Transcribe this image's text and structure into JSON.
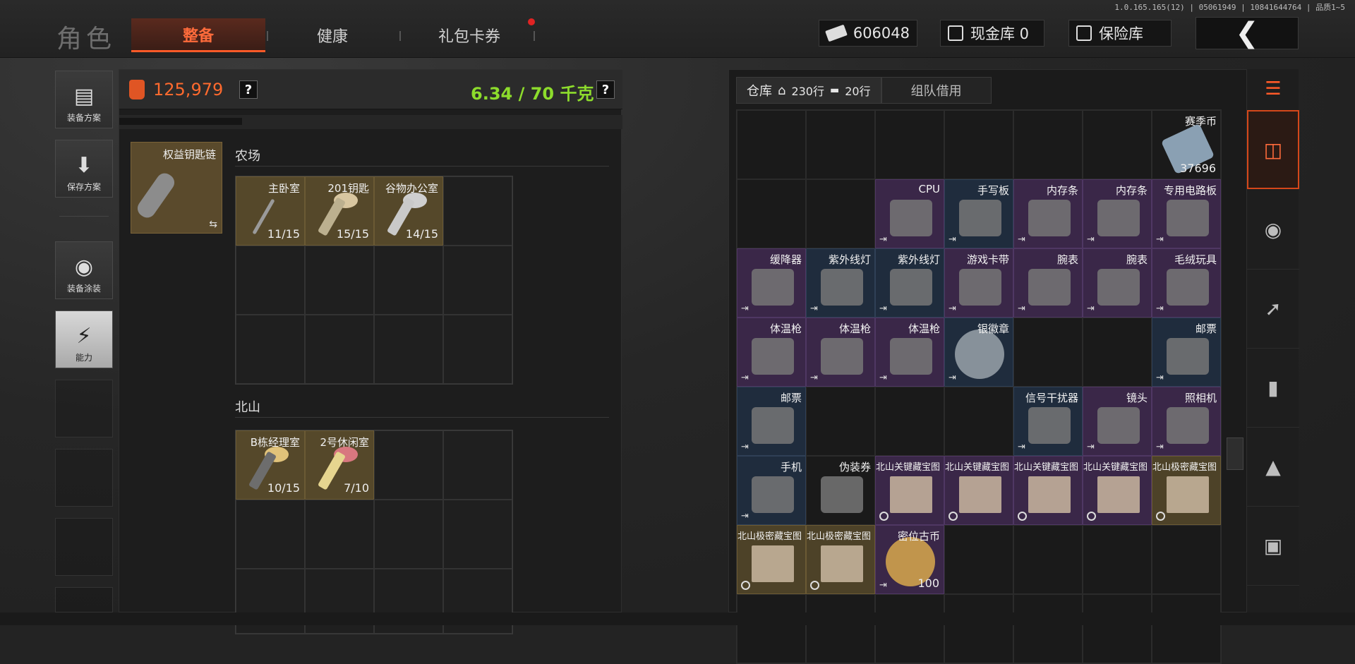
{
  "version": "1.0.165.165(12) | 05061949 | 10841644764 | 品质1~5",
  "header": {
    "role_title": "角色",
    "tabs": [
      "整备",
      "健康",
      "礼包卡券"
    ],
    "cash": "606048",
    "cash_vault": "现金库 0",
    "safe_box": "保险库",
    "back_icon": "back-arrow-icon"
  },
  "sidebar": {
    "items": [
      {
        "label": "装备方案",
        "icon": "vest-icon"
      },
      {
        "label": "保存方案",
        "icon": "save-download-icon"
      },
      {
        "label": "装备涂装",
        "icon": "helmet-paint-icon"
      },
      {
        "label": "能力",
        "icon": "ability-lightning-icon"
      }
    ]
  },
  "loadout": {
    "value": "125,979",
    "weight": "6.34 / 70 千克",
    "help": "?",
    "keychain_label": "权益钥匙链",
    "sections": [
      {
        "title": "农场",
        "keys": [
          {
            "name": "主卧室",
            "count": "11/15"
          },
          {
            "name": "201钥匙",
            "count": "15/15"
          },
          {
            "name": "谷物办公室",
            "count": "14/15"
          }
        ]
      },
      {
        "title": "北山",
        "keys": [
          {
            "name": "B栋经理室",
            "count": "10/15"
          },
          {
            "name": "2号休闲室",
            "count": "7/10"
          }
        ]
      }
    ]
  },
  "warehouse": {
    "tab_label": "仓库",
    "rows_house": "230行",
    "rows_ticket": "20行",
    "team_borrow": "组队借用",
    "items": [
      {
        "name": "",
        "rarity": "empty"
      },
      {
        "name": "",
        "rarity": "empty"
      },
      {
        "name": "",
        "rarity": "empty"
      },
      {
        "name": "",
        "rarity": "empty"
      },
      {
        "name": "",
        "rarity": "empty"
      },
      {
        "name": "",
        "rarity": "empty"
      },
      {
        "name": "赛季币",
        "rarity": "empty",
        "qty": "37696",
        "pic": "money"
      },
      {
        "name": "",
        "rarity": "empty"
      },
      {
        "name": "",
        "rarity": "empty"
      },
      {
        "name": "CPU",
        "rarity": "purple",
        "pic": "chip"
      },
      {
        "name": "手写板",
        "rarity": "blue",
        "pic": "device"
      },
      {
        "name": "内存条",
        "rarity": "purple",
        "pic": "stick"
      },
      {
        "name": "内存条",
        "rarity": "purple",
        "pic": "stick"
      },
      {
        "name": "专用电路板",
        "rarity": "purple",
        "pic": "board"
      },
      {
        "name": "缓降器",
        "rarity": "purple",
        "pic": "device"
      },
      {
        "name": "紫外线灯",
        "rarity": "blue",
        "pic": "lamp"
      },
      {
        "name": "紫外线灯",
        "rarity": "blue",
        "pic": "lamp"
      },
      {
        "name": "游戏卡带",
        "rarity": "purple",
        "pic": "cart"
      },
      {
        "name": "腕表",
        "rarity": "purple",
        "pic": "watch"
      },
      {
        "name": "腕表",
        "rarity": "purple",
        "pic": "watch"
      },
      {
        "name": "毛绒玩具",
        "rarity": "purple",
        "pic": "toy"
      },
      {
        "name": "体温枪",
        "rarity": "purple",
        "pic": "gun"
      },
      {
        "name": "体温枪",
        "rarity": "purple",
        "pic": "gun"
      },
      {
        "name": "体温枪",
        "rarity": "purple",
        "pic": "gun"
      },
      {
        "name": "银徽章",
        "rarity": "blue",
        "pic": "silver"
      },
      {
        "name": "",
        "rarity": "empty"
      },
      {
        "name": "",
        "rarity": "empty"
      },
      {
        "name": "邮票",
        "rarity": "blue",
        "pic": "stamp"
      },
      {
        "name": "邮票",
        "rarity": "blue",
        "pic": "stamp"
      },
      {
        "name": "",
        "rarity": "empty"
      },
      {
        "name": "",
        "rarity": "empty"
      },
      {
        "name": "",
        "rarity": "empty"
      },
      {
        "name": "信号干扰器",
        "rarity": "blue",
        "pic": "device"
      },
      {
        "name": "镜头",
        "rarity": "purple",
        "pic": "lens"
      },
      {
        "name": "照相机",
        "rarity": "purple",
        "pic": "camera"
      },
      {
        "name": "手机",
        "rarity": "blue",
        "pic": "phone"
      },
      {
        "name": "伪装券",
        "rarity": "empty",
        "pic": "ticket"
      },
      {
        "name": "北山关键藏宝图",
        "rarity": "purple",
        "pic": "map",
        "timed": true
      },
      {
        "name": "北山关键藏宝图",
        "rarity": "purple",
        "pic": "map",
        "timed": true
      },
      {
        "name": "北山关键藏宝图",
        "rarity": "purple",
        "pic": "map",
        "timed": true
      },
      {
        "name": "北山关键藏宝图",
        "rarity": "purple",
        "pic": "map",
        "timed": true
      },
      {
        "name": "北山极密藏宝图",
        "rarity": "gold",
        "pic": "map",
        "timed": true
      },
      {
        "name": "北山极密藏宝图",
        "rarity": "gold",
        "pic": "map",
        "timed": true
      },
      {
        "name": "北山极密藏宝图",
        "rarity": "gold",
        "pic": "map",
        "timed": true
      },
      {
        "name": "密位古币",
        "rarity": "purple",
        "pic": "coin",
        "qty": "100"
      },
      {
        "name": "",
        "rarity": "empty"
      },
      {
        "name": "",
        "rarity": "empty"
      },
      {
        "name": "",
        "rarity": "empty"
      },
      {
        "name": "",
        "rarity": "empty"
      },
      {
        "name": "",
        "rarity": "empty"
      },
      {
        "name": "",
        "rarity": "empty"
      },
      {
        "name": "",
        "rarity": "empty"
      },
      {
        "name": "",
        "rarity": "empty"
      },
      {
        "name": "",
        "rarity": "empty"
      },
      {
        "name": "",
        "rarity": "empty"
      },
      {
        "name": "",
        "rarity": "empty"
      }
    ]
  },
  "rightbar": {
    "icons": [
      "sort-refresh-icon",
      "stack-store-icon",
      "helmet-icon",
      "rifle-icon",
      "magazine-icon",
      "ammo-icon",
      "scope-icon"
    ]
  },
  "colors": {
    "accent": "#ff5a28",
    "weight_green": "#8ddc2c",
    "purple": "#3a2748",
    "blue": "#1f2c3d",
    "gold": "#4d4228"
  }
}
